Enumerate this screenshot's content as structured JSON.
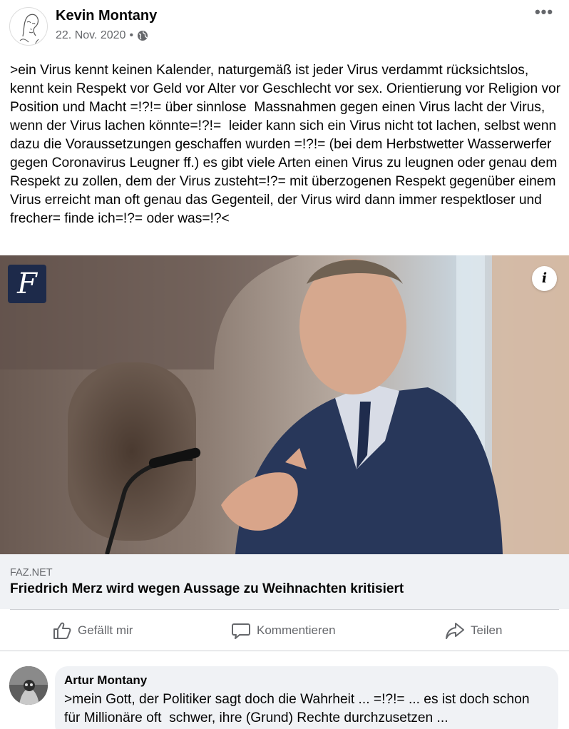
{
  "post": {
    "author_name": "Kevin Montany",
    "date": "22. Nov. 2020",
    "separator": "•",
    "audience_icon": "globe-icon",
    "more_icon": "more-options-icon",
    "more_label": "•••",
    "text": ">ein Virus kennt keinen Kalender, naturgemäß ist jeder Virus verdammt rücksichtslos, kennt kein Respekt vor Geld vor Alter vor Geschlecht vor sex. Orientierung vor Religion vor Position und Macht =!?!= über sinnlose  Massnahmen gegen einen Virus lacht der Virus, wenn der Virus lachen könnte=!?!=  leider kann sich ein Virus nicht tot lachen, selbst wenn dazu die Voraussetzungen geschaffen wurden =!?!= (bei dem Herbstwetter Wasserwerfer gegen Coronavirus Leugner ff.) es gibt viele Arten einen Virus zu leugnen oder genau dem Respekt zu zollen, dem der Virus zusteht=!?= mit überzogenen Respekt gegenüber einem Virus erreicht man oft genau das Gegenteil, der Virus wird dann immer respektloser und frecher= finde ich=!?= oder was=!?<"
  },
  "link": {
    "publisher_logo_letter": "F",
    "info_icon_label": "i",
    "domain": "FAZ.NET",
    "title": "Friedrich Merz wird wegen Aussage zu Weihnachten kritisiert"
  },
  "actions": {
    "like_label": "Gefällt mir",
    "like_icon": "thumbs-up-icon",
    "comment_label": "Kommentieren",
    "comment_icon": "speech-bubble-icon",
    "share_label": "Teilen",
    "share_icon": "share-arrow-icon"
  },
  "comment": {
    "author_name": "Artur Montany",
    "text": ">mein Gott, der Politiker sagt doch die Wahrheit ... =!?!= ... es ist doch schon für Millionäre oft  schwer, ihre (Grund) Rechte durchzusetzen ..."
  },
  "colors": {
    "text_primary": "#050505",
    "text_secondary": "#65676b",
    "preview_bg": "#f0f2f5",
    "faz_logo_bg": "#1d2a4a",
    "divider": "#ced0d4"
  }
}
